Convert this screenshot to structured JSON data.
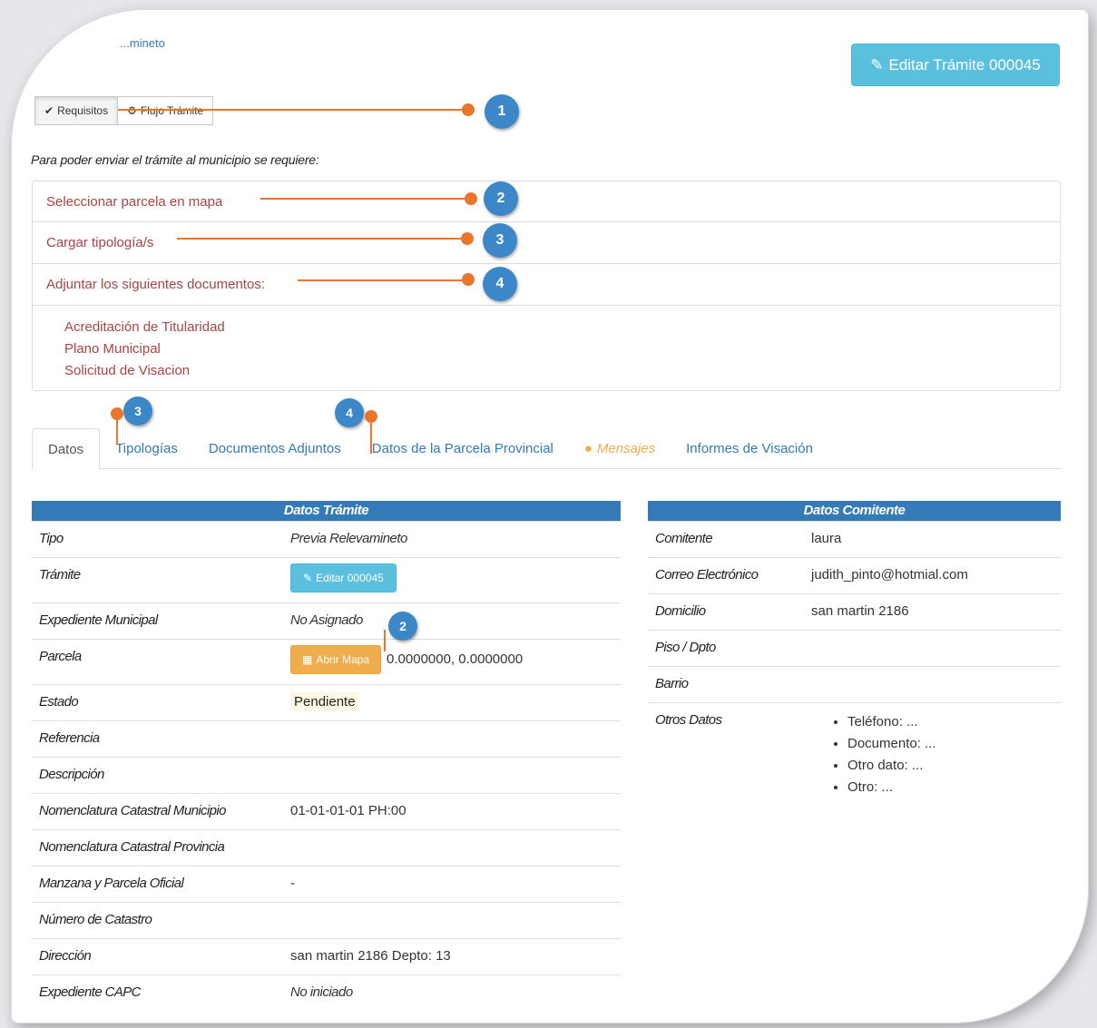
{
  "breadcrumb": "...mineto",
  "header": {
    "edit_button": "Editar Trámite 000045"
  },
  "button_group": {
    "requisitos": "Requisitos",
    "flujo": "Flujo Trámite"
  },
  "intro": "Para poder enviar el trámite al municipio se requiere:",
  "requirements": [
    "Seleccionar parcela en mapa",
    "Cargar tipología/s",
    "Adjuntar los siguientes documentos:"
  ],
  "documents": [
    "Acreditación de Titularidad",
    "Plano Municipal",
    "Solicitud de Visacion"
  ],
  "tabs": [
    "Datos",
    "Tipologías",
    "Documentos Adjuntos",
    "Datos de la Parcela Provincial",
    "Mensajes",
    "Informes de Visación"
  ],
  "datos_tramite": {
    "title": "Datos Trámite",
    "tipo_label": "Tipo",
    "tipo_value": "Previa Relevamineto",
    "tramite_label": "Trámite",
    "tramite_button": "Editar 000045",
    "expediente_label": "Expediente Municipal",
    "expediente_value": "No Asignado",
    "parcela_label": "Parcela",
    "parcela_button": "Abrir Mapa",
    "parcela_coords": "0.0000000, 0.0000000",
    "estado_label": "Estado",
    "estado_value": "Pendiente",
    "referencia_label": "Referencia",
    "descripcion_label": "Descripción",
    "nom_muni_label": "Nomenclatura Catastral Municipio",
    "nom_muni_value": "01-01-01-01 PH:00",
    "nom_prov_label": "Nomenclatura Catastral Provincia",
    "manzana_label": "Manzana y Parcela Oficial",
    "manzana_value": "-",
    "catastro_label": "Número de Catastro",
    "direccion_label": "Dirección",
    "direccion_value": "san martin 2186 Depto: 13",
    "capc_label": "Expediente CAPC",
    "capc_value": "No iniciado"
  },
  "datos_comitente": {
    "title": "Datos Comitente",
    "comitente_label": "Comitente",
    "comitente_value": "laura",
    "correo_label": "Correo Electrónico",
    "correo_value": "judith_pinto@hotmial.com",
    "domicilio_label": "Domicilio",
    "domicilio_value": "san martin 2186",
    "piso_label": "Piso / Dpto",
    "barrio_label": "Barrio",
    "otros_label": "Otros Datos",
    "otros": [
      "Teléfono: ...",
      "Documento: ...",
      "Otro dato: ...",
      "Otro: ..."
    ]
  },
  "callouts": {
    "c1": "1",
    "c2": "2",
    "c3": "3",
    "c4": "4"
  },
  "colors": {
    "primary": "#337ab7",
    "info": "#5bc0de",
    "warning": "#f0ad4e",
    "danger_text": "#a94442",
    "callout_line": "#e8762d",
    "callout_badge": "#3b87c7"
  }
}
